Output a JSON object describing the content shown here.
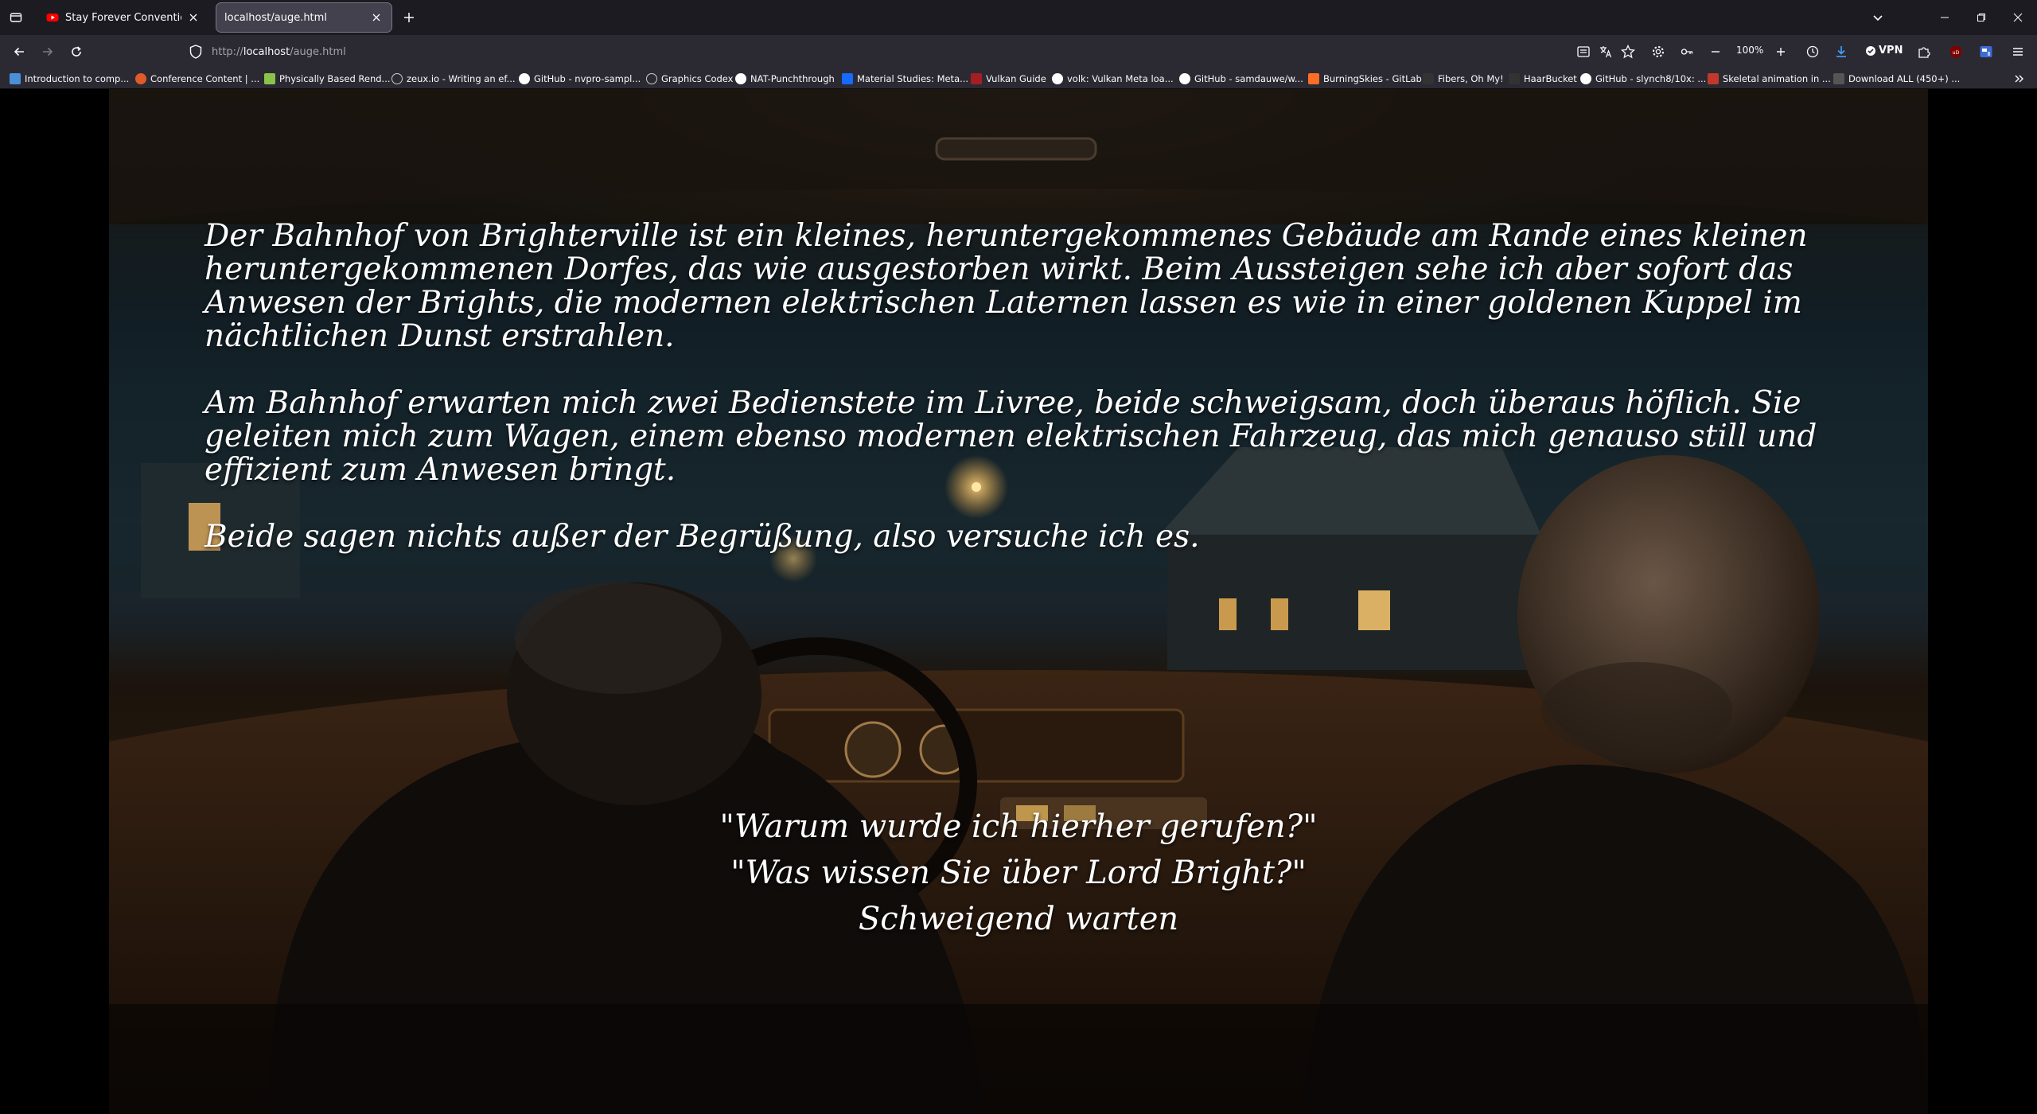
{
  "tabs": [
    {
      "title": "Stay Forever Convention Süd Ta",
      "favicon": "youtube-icon"
    },
    {
      "title": "localhost/auge.html",
      "favicon": "none"
    }
  ],
  "nav": {
    "url_protocol": "http://",
    "url_host": "localhost",
    "url_path": "/auge.html",
    "zoom": "100%",
    "vpn_label": "VPN"
  },
  "bookmarks": [
    {
      "label": "Introduction to comp...",
      "color": "#4a90d9"
    },
    {
      "label": "Conference Content | ...",
      "color": "#e05a2a"
    },
    {
      "label": "Physically Based Rend...",
      "color": "#8bc34a"
    },
    {
      "label": "zeux.io - Writing an ef...",
      "color": "#cccccc"
    },
    {
      "label": "GitHub - nvpro-sampl...",
      "color": "#ffffff"
    },
    {
      "label": "Graphics Codex",
      "color": "#cccccc"
    },
    {
      "label": "NAT-Punchthrough",
      "color": "#ffffff"
    },
    {
      "label": "Material Studies: Meta...",
      "color": "#1769ff"
    },
    {
      "label": "Vulkan Guide",
      "color": "#a41e22"
    },
    {
      "label": "volk: Vulkan Meta loa...",
      "color": "#ffffff"
    },
    {
      "label": "GitHub - samdauwe/w...",
      "color": "#ffffff"
    },
    {
      "label": "BurningSkies - GitLab",
      "color": "#fc6d26"
    },
    {
      "label": "Fibers, Oh My!",
      "color": "#333333"
    },
    {
      "label": "HaarBucket",
      "color": "#333333"
    },
    {
      "label": "GitHub - slynch8/10x: ...",
      "color": "#ffffff"
    },
    {
      "label": "Skeletal animation in ...",
      "color": "#c0392b"
    },
    {
      "label": "Download ALL (450+) ...",
      "color": "#555555"
    }
  ],
  "story": {
    "paragraphs": [
      "Der Bahnhof von Brighterville ist ein kleines, heruntergekommenes Gebäude am Rande eines kleinen heruntergekommenen Dorfes, das wie ausgestorben wirkt. Beim Aussteigen sehe ich aber sofort das Anwesen der Brights, die modernen elektrischen Laternen lassen es wie in einer goldenen Kuppel im nächtlichen Dunst erstrahlen.",
      "Am Bahnhof erwarten mich zwei Bedienstete im Livree, beide schweigsam, doch überaus höflich. Sie geleiten mich zum Wagen, einem ebenso modernen elektrischen Fahrzeug, das mich genauso still und effizient zum Anwesen bringt.",
      "Beide sagen nichts außer der Begrüßung, also versuche ich es."
    ],
    "choices": [
      "\"Warum wurde ich hierher gerufen?\"",
      "\"Was wissen Sie über Lord Bright?\"",
      "Schweigend warten"
    ]
  }
}
